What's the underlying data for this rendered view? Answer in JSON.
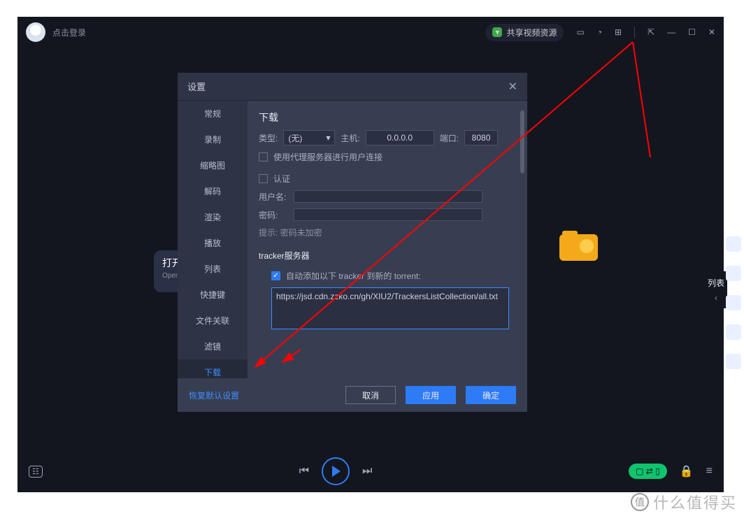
{
  "titlebar": {
    "login_text": "点击登录",
    "share_pill": "共享视频资源"
  },
  "main": {
    "open_card": {
      "cn": "打开文件",
      "en": "Open file"
    },
    "side_tab": {
      "label": "列表",
      "arrow": "‹"
    }
  },
  "dialog": {
    "title": "设置",
    "nav": [
      "常规",
      "录制",
      "缩略图",
      "解码",
      "渲染",
      "播放",
      "列表",
      "快捷键",
      "文件关联",
      "滤镜",
      "下载"
    ],
    "active_nav": "下载",
    "download": {
      "heading": "下载",
      "type_label": "类型:",
      "type_value": "(无)",
      "host_label": "主机:",
      "host_value": "0.0.0.0",
      "port_label": "端口:",
      "port_value": "8080",
      "proxy_user_conn": "使用代理服务器进行用户连接",
      "auth_label": "认证",
      "user_label": "用户名:",
      "pwd_label": "密码:",
      "hint": "提示: 密码未加密",
      "tracker_heading": "tracker服务器",
      "auto_add_label": "自动添加以下 tracker 到新的 torrent:",
      "tracker_url": "https://jsd.cdn.zzko.cn/gh/XIU2/TrackersListCollection/all.txt"
    },
    "footer": {
      "restore": "恢复默认设置",
      "cancel": "取消",
      "apply": "应用",
      "ok": "确定"
    }
  },
  "watermark": {
    "char": "值",
    "text": "什么值得买"
  }
}
